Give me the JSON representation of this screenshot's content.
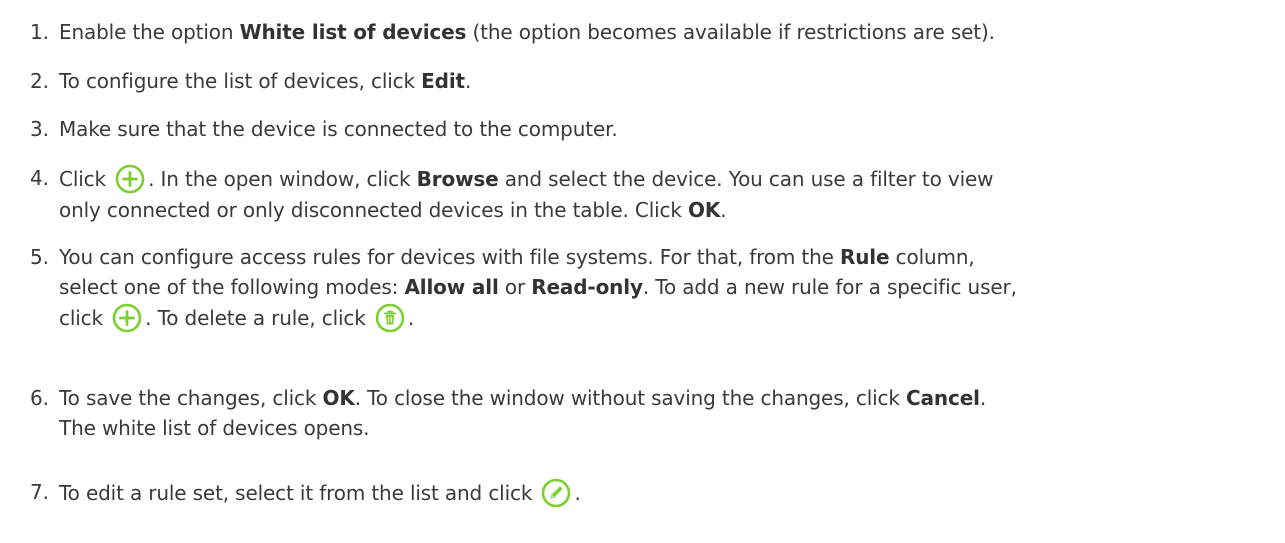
{
  "colors": {
    "text": "#3a3a3a",
    "icon_green": "#7ccf2f",
    "icon_green_fill": "#ffffff"
  },
  "steps": [
    {
      "number": "1.",
      "lines": [
        [
          {
            "t": "Enable the option ",
            "b": false
          },
          {
            "t": "White list of devices",
            "b": true
          },
          {
            "t": " (the option becomes available if restrictions are set).",
            "b": false
          }
        ]
      ]
    },
    {
      "number": "2.",
      "lines": [
        [
          {
            "t": "To configure the list of devices, click ",
            "b": false
          },
          {
            "t": "Edit",
            "b": true
          },
          {
            "t": ".",
            "b": false
          }
        ]
      ]
    },
    {
      "number": "3.",
      "lines": [
        [
          {
            "t": "Make sure that the device is connected to the computer.",
            "b": false
          }
        ]
      ]
    },
    {
      "number": "4.",
      "lines": [
        [
          {
            "t": "Click ",
            "b": false
          },
          {
            "icon": "add-icon"
          },
          {
            "t": ". In the open window, click ",
            "b": false
          },
          {
            "t": "Browse",
            "b": true
          },
          {
            "t": " and select the device. You can use a filter to view",
            "b": false
          }
        ],
        [
          {
            "t": "only connected or only disconnected devices in the table. Click ",
            "b": false
          },
          {
            "t": "OK",
            "b": true
          },
          {
            "t": ".",
            "b": false
          }
        ]
      ]
    },
    {
      "number": "5.",
      "lines": [
        [
          {
            "t": "You can configure access rules for devices with file systems. For that, from the ",
            "b": false
          },
          {
            "t": "Rule",
            "b": true
          },
          {
            "t": " column,",
            "b": false
          }
        ],
        [
          {
            "t": "select one of the following modes: ",
            "b": false
          },
          {
            "t": "Allow all",
            "b": true
          },
          {
            "t": " or ",
            "b": false
          },
          {
            "t": "Read-only",
            "b": true
          },
          {
            "t": ". To add a new rule for a specific user,",
            "b": false
          }
        ],
        [
          {
            "t": "click ",
            "b": false
          },
          {
            "icon": "add-icon"
          },
          {
            "t": ". To delete a rule, click ",
            "b": false
          },
          {
            "icon": "trash-icon"
          },
          {
            "t": ".",
            "b": false
          }
        ]
      ]
    },
    {
      "number": "6.",
      "lines": [
        [
          {
            "t": "To save the changes, click ",
            "b": false
          },
          {
            "t": "OK",
            "b": true
          },
          {
            "t": ". To close the window without saving the changes, click ",
            "b": false
          },
          {
            "t": "Cancel",
            "b": true
          },
          {
            "t": ".",
            "b": false
          }
        ],
        [
          {
            "t": "The white list of devices opens.",
            "b": false
          }
        ]
      ]
    },
    {
      "number": "7.",
      "lines": [
        [
          {
            "t": "To edit a rule set, select it from the list and click ",
            "b": false
          },
          {
            "icon": "edit-icon"
          },
          {
            "t": ".",
            "b": false
          }
        ]
      ]
    }
  ]
}
